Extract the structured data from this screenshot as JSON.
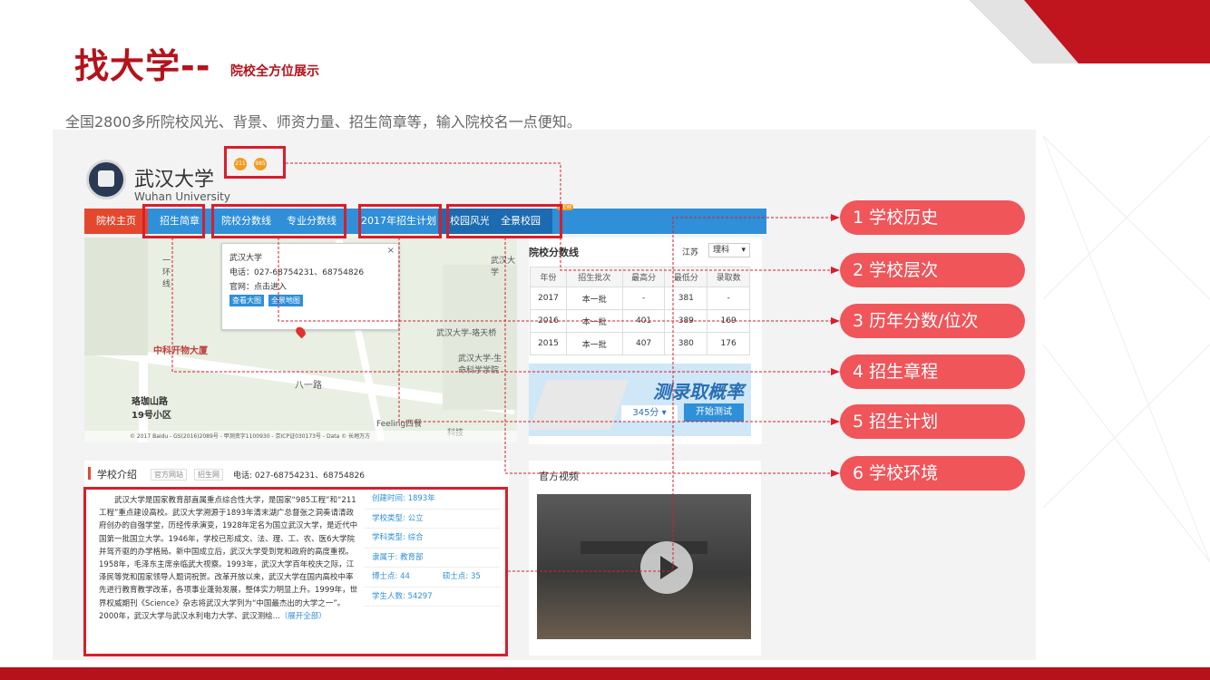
{
  "slide": {
    "title": "找大学--",
    "subtitle": "院校全方位展示",
    "description": "全国2800多所院校风光、背景、师资力量、招生简章等，输入院校名一点便知。",
    "accent_color": "#b5121b"
  },
  "university": {
    "name_cn": "武汉大学",
    "name_en": "Wuhan University",
    "badges": [
      "211",
      "985"
    ]
  },
  "nav": {
    "items": [
      "院校主页",
      "招生简章",
      "院校分数线",
      "专业分数线",
      "2017年招生计划",
      "校园风光",
      "全景校园"
    ],
    "new_badge": "NEW"
  },
  "map": {
    "popup": {
      "name": "武汉大学",
      "phone": "电话：027-68754231、68754826",
      "site": "官网：点击进入",
      "btn1": "查看大图",
      "btn2": "全景地图"
    },
    "labels": [
      "武汉大学",
      "一环线",
      "中科开物大厦",
      "珞珈山路19号小区",
      "八一路",
      "武汉大学-珞天桥",
      "武汉大学-生命科学学院",
      "Feeling西餐",
      "科技"
    ],
    "copyright": "© 2017 Baidu - GS(2016)2089号 - 甲测资字1100930 - 京ICP证030173号 - Data © 长地万方"
  },
  "scores": {
    "title": "院校分数线",
    "province": "江苏",
    "subject": "理科",
    "headers": [
      "年份",
      "招生批次",
      "最高分",
      "最低分",
      "录取数"
    ],
    "rows": [
      [
        "2017",
        "本一批",
        "-",
        "381",
        "-"
      ],
      [
        "2016",
        "本一批",
        "401",
        "389",
        "169"
      ],
      [
        "2015",
        "本一批",
        "407",
        "380",
        "176"
      ]
    ]
  },
  "ad": {
    "title": "测录取概率",
    "score": "345分 ▾",
    "button": "开始测试"
  },
  "intro": {
    "title": "学校介绍",
    "tag1": "官方网站",
    "tag2": "招生网",
    "phone": "电话: 027-68754231、68754826",
    "text": "武汉大学是国家教育部直属重点综合性大学，是国家“985工程”和“211工程”重点建设高校。武汉大学溯源于1893年清末湖广总督张之洞奏请清政府创办的自强学堂，历经传承演变，1928年定名为国立武汉大学，是近代中国第一批国立大学。1946年，学校已形成文、法、理、工、农、医6大学院并驾齐驱的办学格局。新中国成立后，武汉大学受到党和政府的高度重视。1958年，毛泽东主席亲临武大视察。1993年，武汉大学百年校庆之际，江泽民等党和国家领导人题词祝贺。改革开放以来，武汉大学在国内高校中率先进行教育教学改革，各项事业蓬勃发展，整体实力明显上升。1999年，世界权威期刊《Science》杂志将武汉大学列为“中国最杰出的大学之一”。2000年，武汉大学与武汉水利电力大学、武汉测绘...",
    "more": "（展开全部）",
    "facts": [
      "创建时间: 1893年",
      "学校类型: 公立",
      "学科类型: 综合",
      "隶属于: 教育部",
      "博士点: 44",
      "硕士点: 35",
      "学生人数: 54297"
    ]
  },
  "video": {
    "title": "官方视频"
  },
  "callouts": [
    "1 学校历史",
    "2 学校层次",
    "3 历年分数/位次",
    "4 招生章程",
    "5 招生计划",
    "6 学校环境"
  ]
}
